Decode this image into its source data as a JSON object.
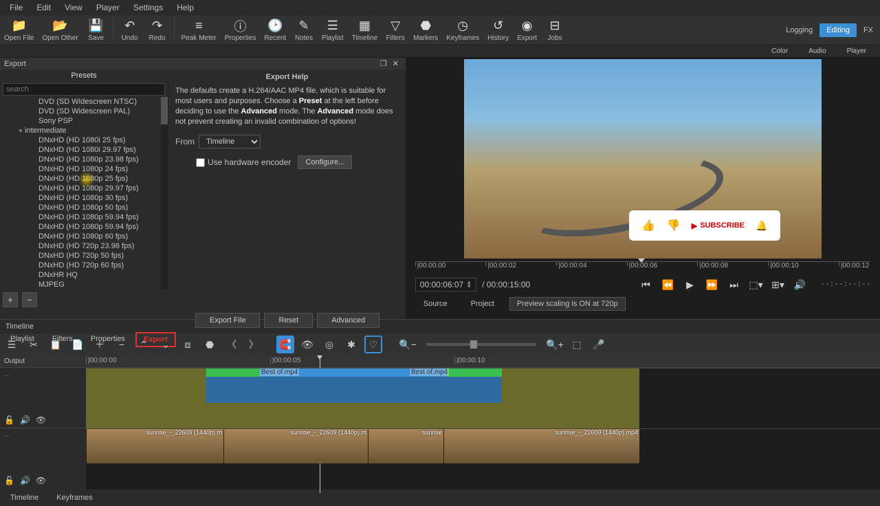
{
  "menu": [
    "File",
    "Edit",
    "View",
    "Player",
    "Settings",
    "Help"
  ],
  "toolbar": [
    {
      "icon": "📁",
      "label": "Open File"
    },
    {
      "icon": "📂",
      "label": "Open Other"
    },
    {
      "icon": "💾",
      "label": "Save"
    },
    {
      "icon": "↶",
      "label": "Undo"
    },
    {
      "icon": "↷",
      "label": "Redo"
    },
    {
      "icon": "≡",
      "label": "Peak Meter"
    },
    {
      "icon": "ⓘ",
      "label": "Properties"
    },
    {
      "icon": "🕑",
      "label": "Recent"
    },
    {
      "icon": "✎",
      "label": "Notes"
    },
    {
      "icon": "☰",
      "label": "Playlist"
    },
    {
      "icon": "▦",
      "label": "Timeline"
    },
    {
      "icon": "▽",
      "label": "Filters"
    },
    {
      "icon": "⬣",
      "label": "Markers"
    },
    {
      "icon": "◷",
      "label": "Keyframes"
    },
    {
      "icon": "↺",
      "label": "History"
    },
    {
      "icon": "◉",
      "label": "Export"
    },
    {
      "icon": "⊟",
      "label": "Jobs"
    }
  ],
  "modes": {
    "logging": "Logging",
    "editing": "Editing",
    "fx": "FX"
  },
  "modes2": {
    "color": "Color",
    "audio": "Audio",
    "player": "Player"
  },
  "export": {
    "title": "Export",
    "presets_title": "Presets",
    "search": "search",
    "items": [
      "DVD (SD Widescreen NTSC)",
      "DVD (SD Widescreen PAL)",
      "Sony PSP"
    ],
    "category": "intermediate",
    "items2": [
      "DNxHD (HD 1080i 25 fps)",
      "DNxHD (HD 1080i 29.97 fps)",
      "DNxHD (HD 1080p 23.98 fps)",
      "DNxHD (HD 1080p 24 fps)",
      "DNxHD (HD 1080p 25 fps)",
      "DNxHD (HD 1080p 29.97 fps)",
      "DNxHD (HD 1080p 30 fps)",
      "DNxHD (HD 1080p 50 fps)",
      "DNxHD (HD 1080p 59.94 fps)",
      "DNxHD (HD 1080p 59.94 fps)",
      "DNxHD (HD 1080p 60 fps)",
      "DNxHD (HD 720p 23.98 fps)",
      "DNxHD (HD 720p 50 fps)",
      "DNxHD (HD 720p 60 fps)",
      "DNxHR HQ",
      "MJPEG"
    ],
    "help_title": "Export Help",
    "help_html": "The defaults create a H.264/AAC MP4 file, which is suitable for most users and purposes. Choose a <b>Preset</b> at the left before deciding to use the <b>Advanced</b> mode. The <b>Advanced</b> mode does not prevent creating an invalid combination of options!",
    "from_label": "From",
    "from_value": "Timeline",
    "hw_label": "Use hardware encoder",
    "configure": "Configure...",
    "export_file": "Export File",
    "reset": "Reset",
    "advanced": "Advanced"
  },
  "tabs": [
    "Playlist",
    "Filters",
    "Properties",
    "Export"
  ],
  "preview": {
    "subscribe": "SUBSCRIBE",
    "ruler": [
      "00:00:00",
      "00:00:02",
      "00:00:04",
      "00:00:06",
      "00:00:08",
      "00:00:10",
      "00:00:12"
    ],
    "time_current": "00:00:06:07",
    "time_total": "/ 00:00:15:00",
    "time_right": "--:--:--:--",
    "source": "Source",
    "project": "Project",
    "scaling": "Preview scaling is ON at 720p"
  },
  "timeline": {
    "title": "Timeline",
    "output": "Output",
    "ruler": [
      "00:00:00",
      "00:00:05",
      "00:00:10"
    ],
    "clip1": "Best of.mp4",
    "clip2": "Best of.mp4",
    "vclip1": "sunrise_-_22609 (1440p).m",
    "vclip2": "sunrise_-_22609 (1440p).m",
    "vclip3": "sunrise",
    "vclip4": "sunrise_-_22609 (1440p).mp4",
    "tabs": [
      "Timeline",
      "Keyframes"
    ]
  }
}
